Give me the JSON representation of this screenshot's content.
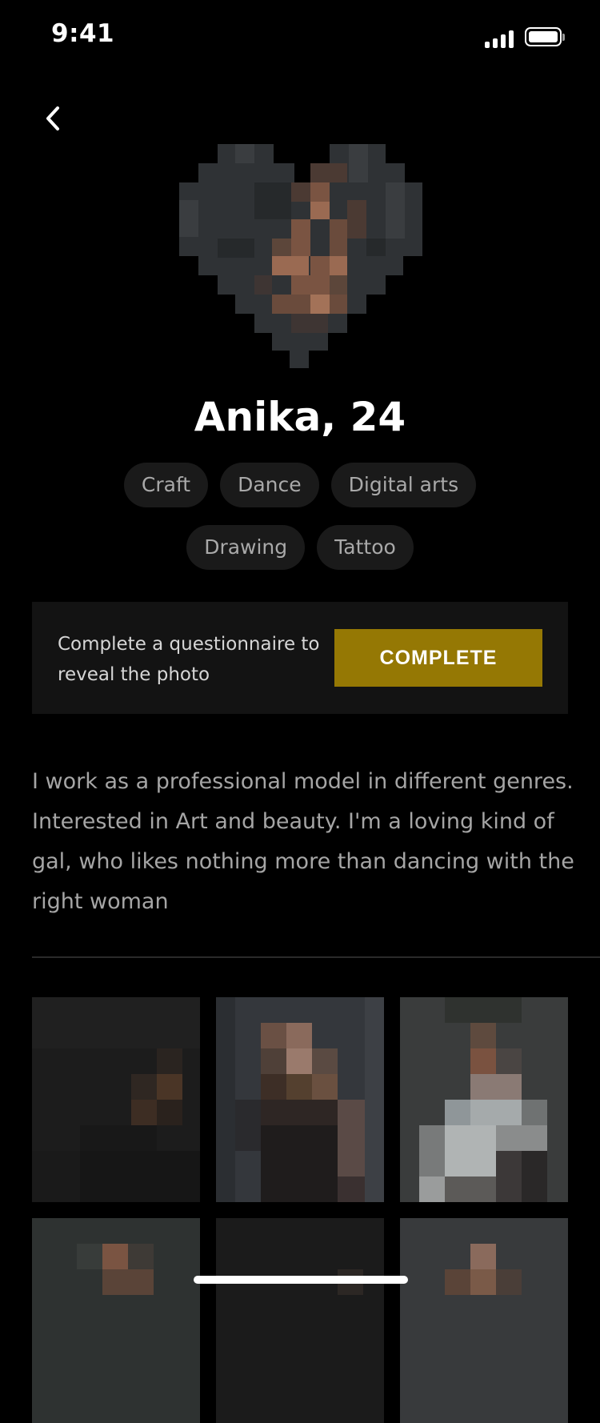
{
  "status_bar": {
    "time": "9:41"
  },
  "profile": {
    "name_age": "Anika, 24",
    "interests": [
      [
        "Craft",
        "Dance",
        "Digital arts"
      ],
      [
        "Drawing",
        "Tattoo"
      ]
    ]
  },
  "reveal_card": {
    "text": "Complete a questionnaire to reveal the photo",
    "button_label": "COMPLETE",
    "accent_color": "#957804"
  },
  "bio": "I work as a professional model in different genres. Interested in Art and beauty. I'm a loving kind of gal, who likes nothing more than dancing with the right woman",
  "gallery": {
    "photos_count_visible": 6
  },
  "icons": {
    "back": "chevron-left-icon",
    "signal": "cellular-signal-icon",
    "battery": "battery-icon"
  }
}
